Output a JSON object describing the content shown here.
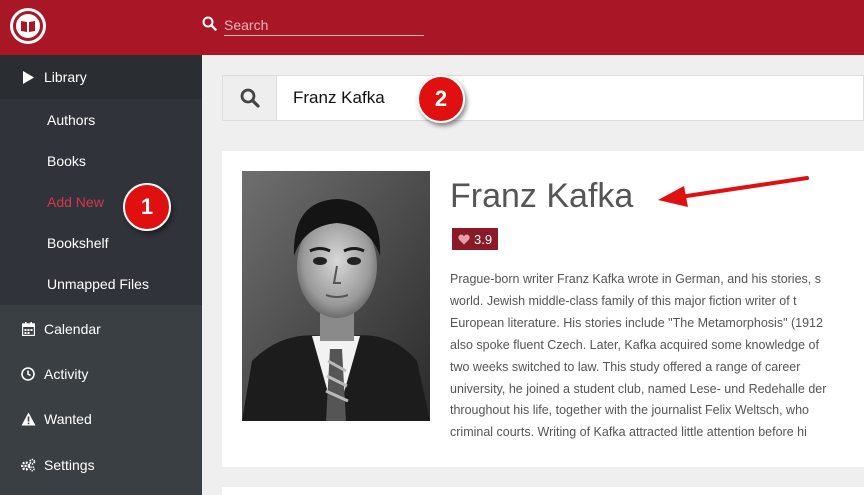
{
  "topbar": {
    "search_placeholder": "Search",
    "logo_icon": "book-logo-icon"
  },
  "sidebar": {
    "library": "Library",
    "sub_items": [
      "Authors",
      "Books",
      "Add New",
      "Bookshelf",
      "Unmapped Files"
    ],
    "calendar": "Calendar",
    "activity": "Activity",
    "wanted": "Wanted",
    "settings": "Settings"
  },
  "search": {
    "value": "Franz Kafka"
  },
  "author": {
    "name": "Franz Kafka",
    "rating": "3.9",
    "overview_lines": [
      "Prague-born writer Franz Kafka wrote in German, and his stories, s",
      "world. Jewish middle-class family of this major fiction writer of t",
      "European literature. His stories include \"The Metamorphosis\" (1912",
      "also spoke fluent Czech. Later, Kafka acquired some knowledge of",
      "two weeks switched to law. This study offered a range of career",
      "university, he joined a student club, named Lese- und Redehalle der",
      "throughout his life, together with the journalist Felix Weltsch, who",
      "criminal courts. Writing of Kafka attracted little attention before hi"
    ]
  },
  "callouts": [
    "1",
    "2"
  ],
  "colors": {
    "brand": "#a91625",
    "sidebar": "#3a3f44",
    "active_link": "#d9354a",
    "rating": "#8b1a26"
  }
}
